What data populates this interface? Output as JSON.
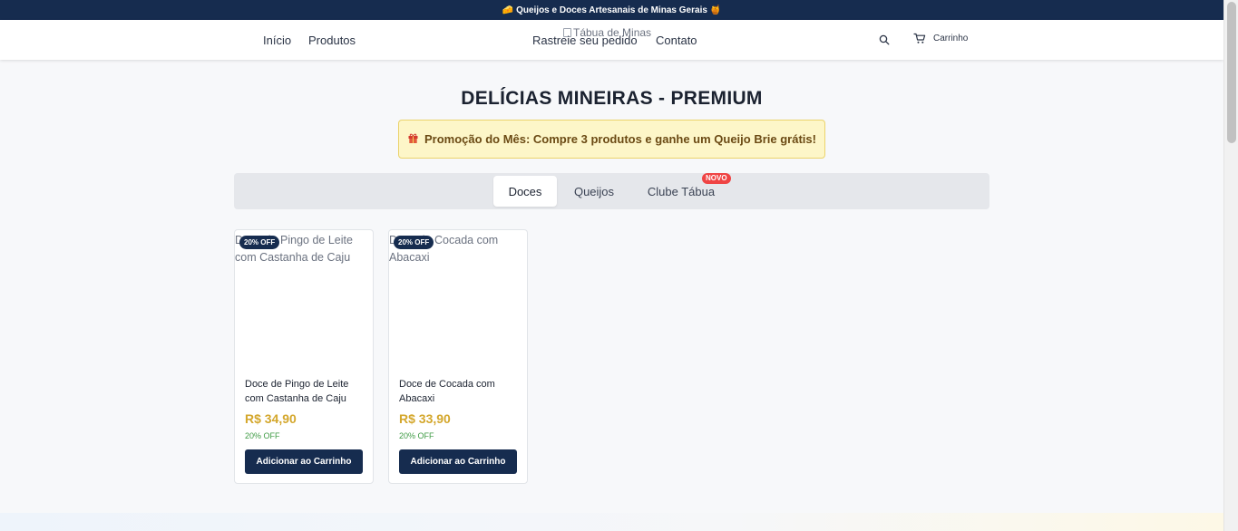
{
  "announcement": "🧀 Queijos e Doces Artesanais de Minas Gerais 🍯",
  "nav": {
    "links": [
      "Início",
      "Produtos",
      "Rastreie seu pedido",
      "Contato"
    ],
    "logo_alt": "Tábua de Minas",
    "cart_label": "Carrinho",
    "search_icon": "search-icon",
    "cart_icon": "cart-icon"
  },
  "page_title": "DELÍCIAS MINEIRAS - PREMIUM",
  "promo": {
    "icon": "gift-icon",
    "text": "Promoção do Mês: Compre 3 produtos e ganhe um Queijo Brie grátis!"
  },
  "tabs": {
    "items": [
      "Doces",
      "Queijos",
      "Clube Tábua"
    ],
    "active": "Doces",
    "new_badge": "NOVO"
  },
  "products": [
    {
      "image_alt": "Doce de Pingo de Leite com Castanha de Caju",
      "discount_badge": "20% OFF",
      "name": "Doce de Pingo de Leite com Castanha de Caju",
      "price": "R$ 34,90",
      "discount_text": "20% OFF",
      "button": "Adicionar ao Carrinho"
    },
    {
      "image_alt": "Doce de Cocada com Abacaxi",
      "discount_badge": "20% OFF",
      "name": "Doce de Cocada com Abacaxi",
      "price": "R$ 33,90",
      "discount_text": "20% OFF",
      "button": "Adicionar ao Carrinho"
    }
  ],
  "colors": {
    "navy": "#162c4f",
    "gold_price": "#d4a72c",
    "green_discount": "#3d9a43",
    "badge_red": "#ef4444",
    "promo_bg": "#fdf6c8"
  }
}
